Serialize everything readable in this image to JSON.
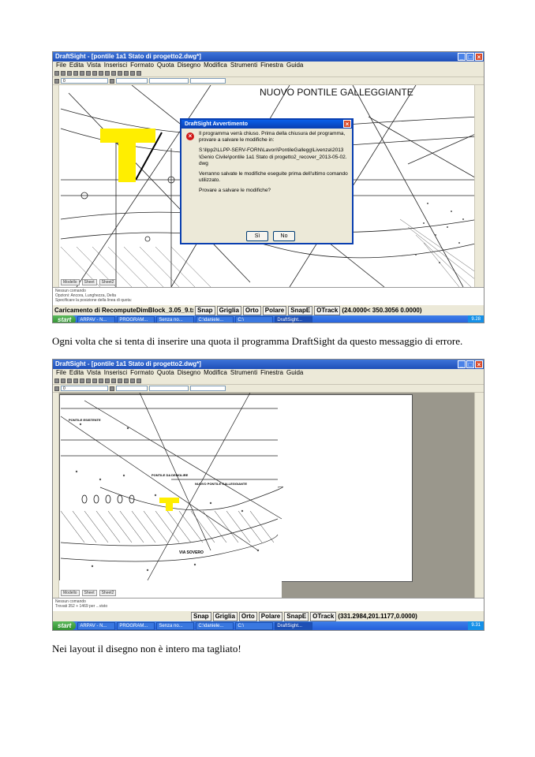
{
  "screenshot1": {
    "app_title": "DraftSight - [pontile 1a1 Stato di progetto2.dwg*]",
    "menu": [
      "File",
      "Edita",
      "Vista",
      "Inserisci",
      "Formato",
      "Quota",
      "Disegno",
      "Modifica",
      "Strumenti",
      "Finestra",
      "Guida"
    ],
    "layer_combo": "0",
    "drawing_heading": "NUOVO PONTILE GALLEGGIANTE",
    "tabs": [
      "Modello",
      "Sheet",
      "Sheet2"
    ],
    "command_lines": [
      "Nessun comando",
      "Opzioni: Ancora, Lunghezza, Delta",
      "Specificare la posizione della linea di quota:"
    ],
    "status_text": "Caricamento di RecomputeDimBlock_3.05_9.tx...",
    "status_buttons": [
      "Snap",
      "Griglia",
      "Orto",
      "Polare",
      "SnapE",
      "OTrack"
    ],
    "coords": "(24.0000< 350.3056 0.0000)",
    "dialog": {
      "title": "DraftSight Avvertimento",
      "line1": "Il programma verrà chiuso. Prima della chiusura del programma, provare a salvare le modifiche in:",
      "path": "S:\\llpp2\\LLPP-SERV-FORN\\Lavori\\PontileGallegg\\Livenza\\2013\\Genio Civile\\pontile 1a1 Stato di progetto2_recover_2013-05-02.dwg",
      "line2": "Verranno salvate le modifiche eseguite prima dell'ultimo comando utilizzato.",
      "question": "Provare a salvare le modifiche?",
      "yes": "Sì",
      "no": "No"
    },
    "taskbar": {
      "start": "start",
      "tasks": [
        "ARPAV - N...",
        "PROGRAM...",
        "Senza no...",
        "C:\\daniele...",
        "C:\\",
        "DraftSight..."
      ],
      "clock": "9.28"
    }
  },
  "caption1": "Ogni volta che si tenta di inserire una quota il programma DraftSight da questo messaggio di errore.",
  "screenshot2": {
    "app_title": "DraftSight - [pontile 1a1 Stato di progetto2.dwg*]",
    "menu": [
      "File",
      "Edita",
      "Vista",
      "Inserisci",
      "Formato",
      "Quota",
      "Disegno",
      "Modifica",
      "Strumenti",
      "Finestra",
      "Guida"
    ],
    "layer_combo": "0",
    "labels": [
      "PONTILE DA DEMOLIRE",
      "NUOVO PONTILE GALLEGGIANTE",
      "VIA SOVERO",
      "PONTILE ESISTENTE"
    ],
    "tabs": [
      "Modello",
      "Sheet",
      "Sheet2"
    ],
    "command_lines": [
      "Nessun comando",
      "Trovati 352 + 1469 per ...visto"
    ],
    "status_buttons": [
      "Snap",
      "Griglia",
      "Orto",
      "Polare",
      "SnapE",
      "OTrack"
    ],
    "coords": "(331.2984,201.1177,0.0000)",
    "taskbar": {
      "start": "start",
      "tasks": [
        "ARPAV - N...",
        "PROGRAM...",
        "Senza no...",
        "C:\\daniele...",
        "C:\\",
        "DraftSight..."
      ],
      "clock": "9.31"
    }
  },
  "caption2": "Nei layout il disegno non è intero ma tagliato!",
  "colors": {
    "titlebar": "#245edb",
    "highlight": "#ffee00",
    "close": "#d84a2a"
  }
}
